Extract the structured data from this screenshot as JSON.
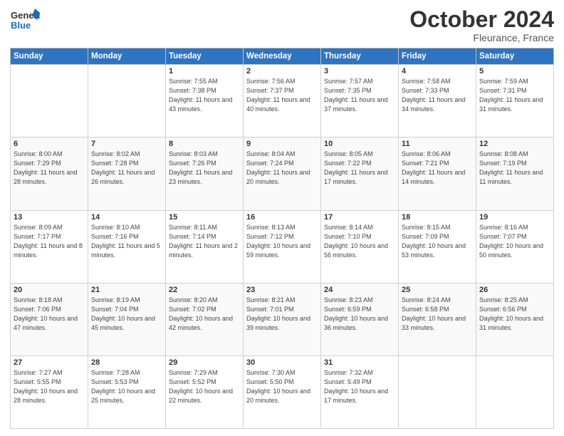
{
  "header": {
    "logo_line1": "General",
    "logo_line2": "Blue",
    "month_title": "October 2024",
    "location": "Fleurance, France"
  },
  "weekdays": [
    "Sunday",
    "Monday",
    "Tuesday",
    "Wednesday",
    "Thursday",
    "Friday",
    "Saturday"
  ],
  "weeks": [
    [
      {
        "day": "",
        "info": ""
      },
      {
        "day": "",
        "info": ""
      },
      {
        "day": "1",
        "info": "Sunrise: 7:55 AM\nSunset: 7:38 PM\nDaylight: 11 hours and 43 minutes."
      },
      {
        "day": "2",
        "info": "Sunrise: 7:56 AM\nSunset: 7:37 PM\nDaylight: 11 hours and 40 minutes."
      },
      {
        "day": "3",
        "info": "Sunrise: 7:57 AM\nSunset: 7:35 PM\nDaylight: 11 hours and 37 minutes."
      },
      {
        "day": "4",
        "info": "Sunrise: 7:58 AM\nSunset: 7:33 PM\nDaylight: 11 hours and 34 minutes."
      },
      {
        "day": "5",
        "info": "Sunrise: 7:59 AM\nSunset: 7:31 PM\nDaylight: 11 hours and 31 minutes."
      }
    ],
    [
      {
        "day": "6",
        "info": "Sunrise: 8:00 AM\nSunset: 7:29 PM\nDaylight: 11 hours and 28 minutes."
      },
      {
        "day": "7",
        "info": "Sunrise: 8:02 AM\nSunset: 7:28 PM\nDaylight: 11 hours and 26 minutes."
      },
      {
        "day": "8",
        "info": "Sunrise: 8:03 AM\nSunset: 7:26 PM\nDaylight: 11 hours and 23 minutes."
      },
      {
        "day": "9",
        "info": "Sunrise: 8:04 AM\nSunset: 7:24 PM\nDaylight: 11 hours and 20 minutes."
      },
      {
        "day": "10",
        "info": "Sunrise: 8:05 AM\nSunset: 7:22 PM\nDaylight: 11 hours and 17 minutes."
      },
      {
        "day": "11",
        "info": "Sunrise: 8:06 AM\nSunset: 7:21 PM\nDaylight: 11 hours and 14 minutes."
      },
      {
        "day": "12",
        "info": "Sunrise: 8:08 AM\nSunset: 7:19 PM\nDaylight: 11 hours and 11 minutes."
      }
    ],
    [
      {
        "day": "13",
        "info": "Sunrise: 8:09 AM\nSunset: 7:17 PM\nDaylight: 11 hours and 8 minutes."
      },
      {
        "day": "14",
        "info": "Sunrise: 8:10 AM\nSunset: 7:16 PM\nDaylight: 11 hours and 5 minutes."
      },
      {
        "day": "15",
        "info": "Sunrise: 8:11 AM\nSunset: 7:14 PM\nDaylight: 11 hours and 2 minutes."
      },
      {
        "day": "16",
        "info": "Sunrise: 8:13 AM\nSunset: 7:12 PM\nDaylight: 10 hours and 59 minutes."
      },
      {
        "day": "17",
        "info": "Sunrise: 8:14 AM\nSunset: 7:10 PM\nDaylight: 10 hours and 56 minutes."
      },
      {
        "day": "18",
        "info": "Sunrise: 8:15 AM\nSunset: 7:09 PM\nDaylight: 10 hours and 53 minutes."
      },
      {
        "day": "19",
        "info": "Sunrise: 8:16 AM\nSunset: 7:07 PM\nDaylight: 10 hours and 50 minutes."
      }
    ],
    [
      {
        "day": "20",
        "info": "Sunrise: 8:18 AM\nSunset: 7:06 PM\nDaylight: 10 hours and 47 minutes."
      },
      {
        "day": "21",
        "info": "Sunrise: 8:19 AM\nSunset: 7:04 PM\nDaylight: 10 hours and 45 minutes."
      },
      {
        "day": "22",
        "info": "Sunrise: 8:20 AM\nSunset: 7:02 PM\nDaylight: 10 hours and 42 minutes."
      },
      {
        "day": "23",
        "info": "Sunrise: 8:21 AM\nSunset: 7:01 PM\nDaylight: 10 hours and 39 minutes."
      },
      {
        "day": "24",
        "info": "Sunrise: 8:23 AM\nSunset: 6:59 PM\nDaylight: 10 hours and 36 minutes."
      },
      {
        "day": "25",
        "info": "Sunrise: 8:24 AM\nSunset: 6:58 PM\nDaylight: 10 hours and 33 minutes."
      },
      {
        "day": "26",
        "info": "Sunrise: 8:25 AM\nSunset: 6:56 PM\nDaylight: 10 hours and 31 minutes."
      }
    ],
    [
      {
        "day": "27",
        "info": "Sunrise: 7:27 AM\nSunset: 5:55 PM\nDaylight: 10 hours and 28 minutes."
      },
      {
        "day": "28",
        "info": "Sunrise: 7:28 AM\nSunset: 5:53 PM\nDaylight: 10 hours and 25 minutes."
      },
      {
        "day": "29",
        "info": "Sunrise: 7:29 AM\nSunset: 5:52 PM\nDaylight: 10 hours and 22 minutes."
      },
      {
        "day": "30",
        "info": "Sunrise: 7:30 AM\nSunset: 5:50 PM\nDaylight: 10 hours and 20 minutes."
      },
      {
        "day": "31",
        "info": "Sunrise: 7:32 AM\nSunset: 5:49 PM\nDaylight: 10 hours and 17 minutes."
      },
      {
        "day": "",
        "info": ""
      },
      {
        "day": "",
        "info": ""
      }
    ]
  ]
}
